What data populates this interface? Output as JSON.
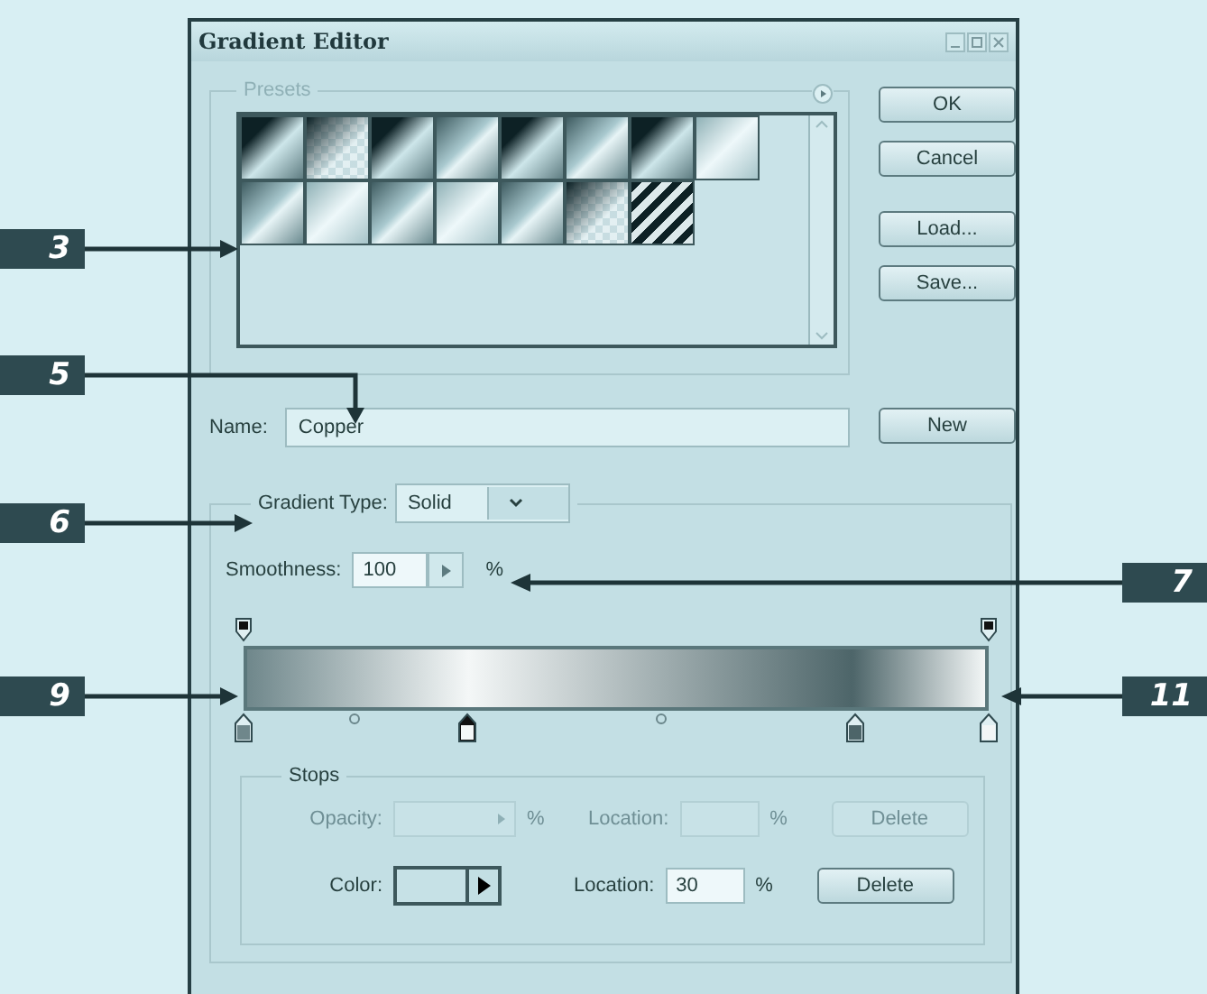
{
  "window": {
    "title": "Gradient Editor"
  },
  "presets": {
    "title": "Presets",
    "swatches": [
      {
        "kind": "dark"
      },
      {
        "kind": "checker"
      },
      {
        "kind": "dark"
      },
      {
        "kind": "medium"
      },
      {
        "kind": "dark"
      },
      {
        "kind": "medium"
      },
      {
        "kind": "dark"
      },
      {
        "kind": "light"
      },
      {
        "kind": "medium"
      },
      {
        "kind": "light"
      },
      {
        "kind": "medium"
      },
      {
        "kind": "light"
      },
      {
        "kind": "medium"
      },
      {
        "kind": "checker"
      },
      {
        "kind": "stripes"
      }
    ]
  },
  "buttons": [
    {
      "label": "OK"
    },
    {
      "label": "Cancel"
    },
    {
      "label": "Load..."
    },
    {
      "label": "Save..."
    }
  ],
  "name": {
    "label": "Name:",
    "value": "Copper",
    "button": "New"
  },
  "gradient_type": {
    "label": "Gradient Type:",
    "value": "Solid"
  },
  "smoothness": {
    "label": "Smoothness:",
    "value": "100",
    "unit": "%"
  },
  "opacity_stops": [
    {
      "level": 0,
      "selected": false
    },
    {
      "level": 1,
      "selected": false
    }
  ],
  "color_stops": [
    {
      "level": 0,
      "color": "#6f878b",
      "selected": false
    },
    {
      "level": 0.3,
      "color": "#f4f7f7",
      "selected": true
    },
    {
      "level": 0.82,
      "color": "#4d6569",
      "selected": false
    },
    {
      "level": 1,
      "color": "#f2f6f6",
      "selected": false
    }
  ],
  "midpoints": [
    {
      "level": 0.15
    },
    {
      "level": 0.56
    }
  ],
  "stops": {
    "title": "Stops",
    "rows": [
      {
        "kind": "opacity",
        "label": "Opacity:",
        "value_unit": "%",
        "location_label": "Location:",
        "location_value": "",
        "location_unit": "%",
        "delete": "Delete",
        "disabled": true
      },
      {
        "kind": "color",
        "label": "Color:",
        "value_unit": "",
        "location_label": "Location:",
        "location_value": "30",
        "location_unit": "%",
        "delete": "Delete",
        "disabled": false
      }
    ]
  },
  "callouts": [
    {
      "label": "3"
    },
    {
      "label": "5"
    },
    {
      "label": "6"
    },
    {
      "label": "7"
    },
    {
      "label": "9"
    },
    {
      "label": "11"
    }
  ]
}
